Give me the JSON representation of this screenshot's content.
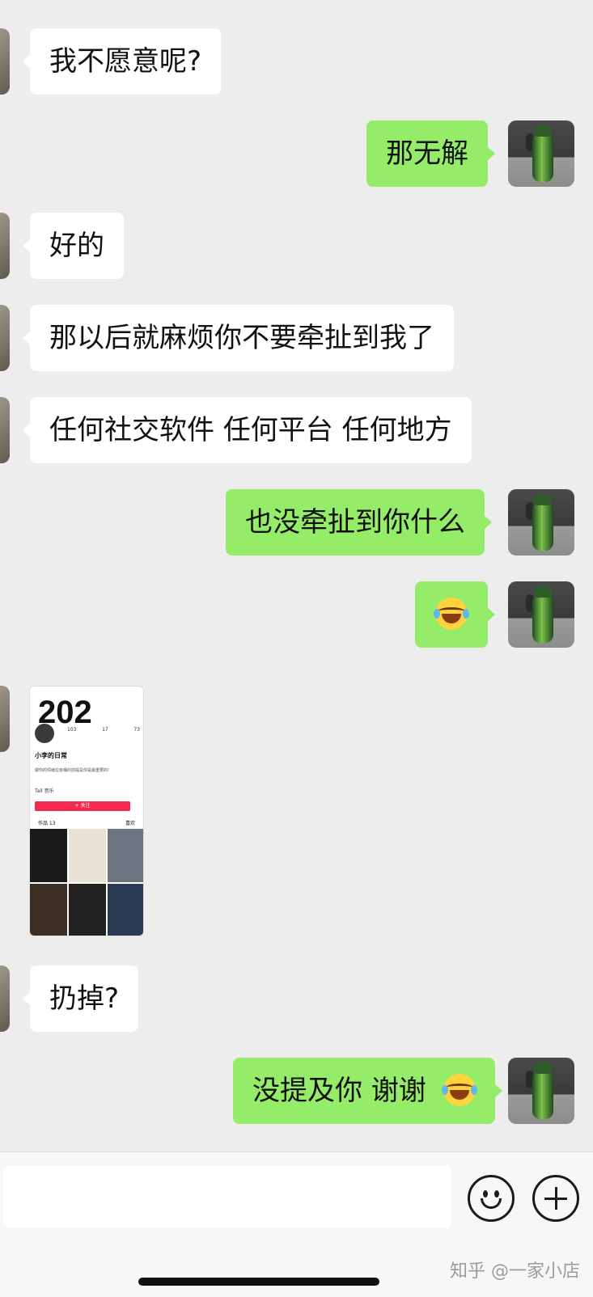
{
  "messages": [
    {
      "side": "left",
      "text": "我不愿意呢?"
    },
    {
      "side": "right",
      "text": "那无解"
    },
    {
      "side": "left",
      "text": "好的"
    },
    {
      "side": "left",
      "text": "那以后就麻烦你不要牵扯到我了"
    },
    {
      "side": "left",
      "text": "任何社交软件 任何平台 任何地方"
    },
    {
      "side": "right",
      "text": "也没牵扯到你什么"
    },
    {
      "side": "right",
      "text": "",
      "emoji": "tears-of-joy"
    },
    {
      "side": "left",
      "type": "image"
    },
    {
      "side": "left",
      "text": "扔掉?"
    },
    {
      "side": "right",
      "text": "没提及你 谢谢",
      "emoji": "tears-of-joy"
    }
  ],
  "shared_screenshot": {
    "big_text": "202",
    "stats": [
      "103",
      "17",
      "73"
    ],
    "name": "小李的日常",
    "bio": "做你的情绪垃圾桶的前提是你是最重要的!",
    "music": "Tall 音乐",
    "follow": "+ 关注",
    "tabs": [
      "作品 13",
      "喜欢"
    ]
  },
  "input": {
    "value": "",
    "placeholder": ""
  },
  "watermark": "知乎 @一家小店",
  "colors": {
    "background": "#ededed",
    "self_bubble": "#95ec69",
    "other_bubble": "#ffffff"
  }
}
